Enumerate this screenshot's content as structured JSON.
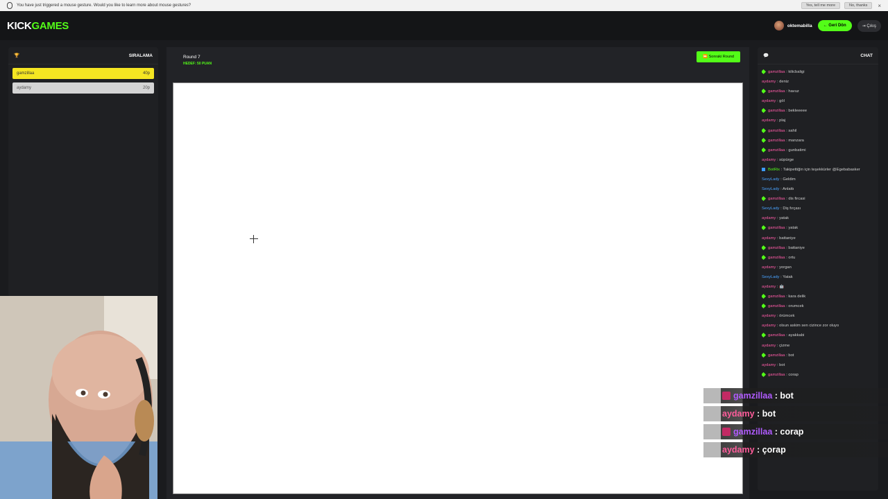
{
  "notification": {
    "text": "You have just triggered a mouse gesture. Would you like to learn more about mouse gestures?",
    "yes_label": "Yes, tell me more",
    "no_label": "No, thanks",
    "close": "×"
  },
  "header": {
    "logo_kick": "KICK",
    "logo_games": "GAMES",
    "username": "oktemabilla",
    "back_label": "← Geri Dön",
    "logout_label": "Çıkış"
  },
  "leaderboard": {
    "title": "SIRALAMA",
    "players": [
      {
        "name": "gamzillaa",
        "score": "40p"
      },
      {
        "name": "aydamy",
        "score": "20p"
      }
    ]
  },
  "game": {
    "round_label": "Round 7",
    "target_label": "HEDEF: 50 PUAN",
    "next_round_label": "Sonraki Round"
  },
  "chat": {
    "title": "CHAT",
    "messages": [
      {
        "user": "gamzillaa",
        "text": "kilicbaligi"
      },
      {
        "user": "aydamy",
        "text": "deniz"
      },
      {
        "user": "gamzillaa",
        "text": "havuz"
      },
      {
        "user": "aydamy",
        "text": "göl"
      },
      {
        "user": "gamzillaa",
        "text": "beklееееe"
      },
      {
        "user": "aydamy",
        "text": "plaj"
      },
      {
        "user": "gamzillaa",
        "text": "sahil"
      },
      {
        "user": "gamzillaa",
        "text": "manzara"
      },
      {
        "user": "gamzillaa",
        "text": "gunbatimi"
      },
      {
        "user": "aydamy",
        "text": "süpürge"
      },
      {
        "user": "BotRix",
        "text": "Takipettiğin için teşekkürler @Egebabasker"
      },
      {
        "user": "SexyLady",
        "text": "Geldim"
      },
      {
        "user": "SexyLady",
        "text": "Anlattı"
      },
      {
        "user": "gamzillaa",
        "text": "dis fircasi"
      },
      {
        "user": "SexyLady",
        "text": "Diş fırçası"
      },
      {
        "user": "aydamy",
        "text": "yatak"
      },
      {
        "user": "gamzillaa",
        "text": "yatak"
      },
      {
        "user": "aydamy",
        "text": "battaniye"
      },
      {
        "user": "gamzillaa",
        "text": "battaniye"
      },
      {
        "user": "gamzillaa",
        "text": "ortu"
      },
      {
        "user": "aydamy",
        "text": "yorgan"
      },
      {
        "user": "SexyLady",
        "text": "Yatak"
      },
      {
        "user": "aydamy",
        "text": "🤖"
      },
      {
        "user": "gamzillaa",
        "text": "kara delik"
      },
      {
        "user": "gamzillaa",
        "text": "orumcek"
      },
      {
        "user": "aydamy",
        "text": "örümcek"
      },
      {
        "user": "aydamy",
        "text": "olsun askim sen cizince zor oluyo"
      },
      {
        "user": "gamzillaa",
        "text": "ayakkabi"
      },
      {
        "user": "aydamy",
        "text": "çizme"
      },
      {
        "user": "gamzillaa",
        "text": "bot"
      },
      {
        "user": "aydamy",
        "text": "bot"
      },
      {
        "user": "gamzillaa",
        "text": "corap"
      }
    ]
  },
  "overlay": {
    "messages": [
      {
        "user": "gamzillaa",
        "text": ": bot"
      },
      {
        "user": "aydamy",
        "text": ": bot"
      },
      {
        "user": "gamzillaa",
        "text": ": corap"
      },
      {
        "user": "aydamy",
        "text": ": çorap"
      }
    ]
  },
  "colors": {
    "accent": "#53fc18",
    "leader": "#f5e622",
    "pink_user": "#ff5ca8",
    "blue_user": "#4aa3ff"
  }
}
